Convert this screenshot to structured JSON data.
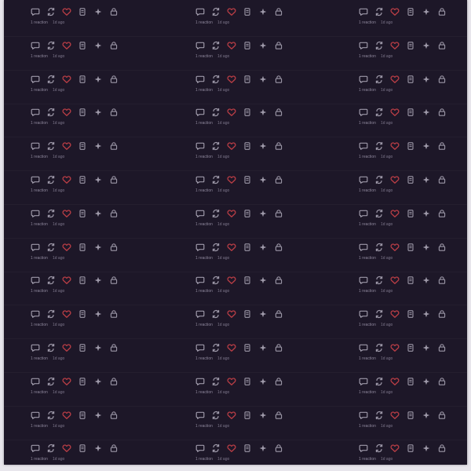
{
  "theme": {
    "background": "#1d1728",
    "icon_color": "#9d98a8",
    "heart_color": "#b73d45",
    "muted_text": "#8d869b"
  },
  "layout": {
    "columns": 3,
    "rows": 14
  },
  "post_actions": {
    "icon_names": [
      "comment-icon",
      "repost-icon",
      "heart-icon",
      "bookmark-icon",
      "sparkle-icon",
      "lock-icon"
    ],
    "reactions_text": "1 reaction",
    "timestamp_text": "1d ago"
  }
}
